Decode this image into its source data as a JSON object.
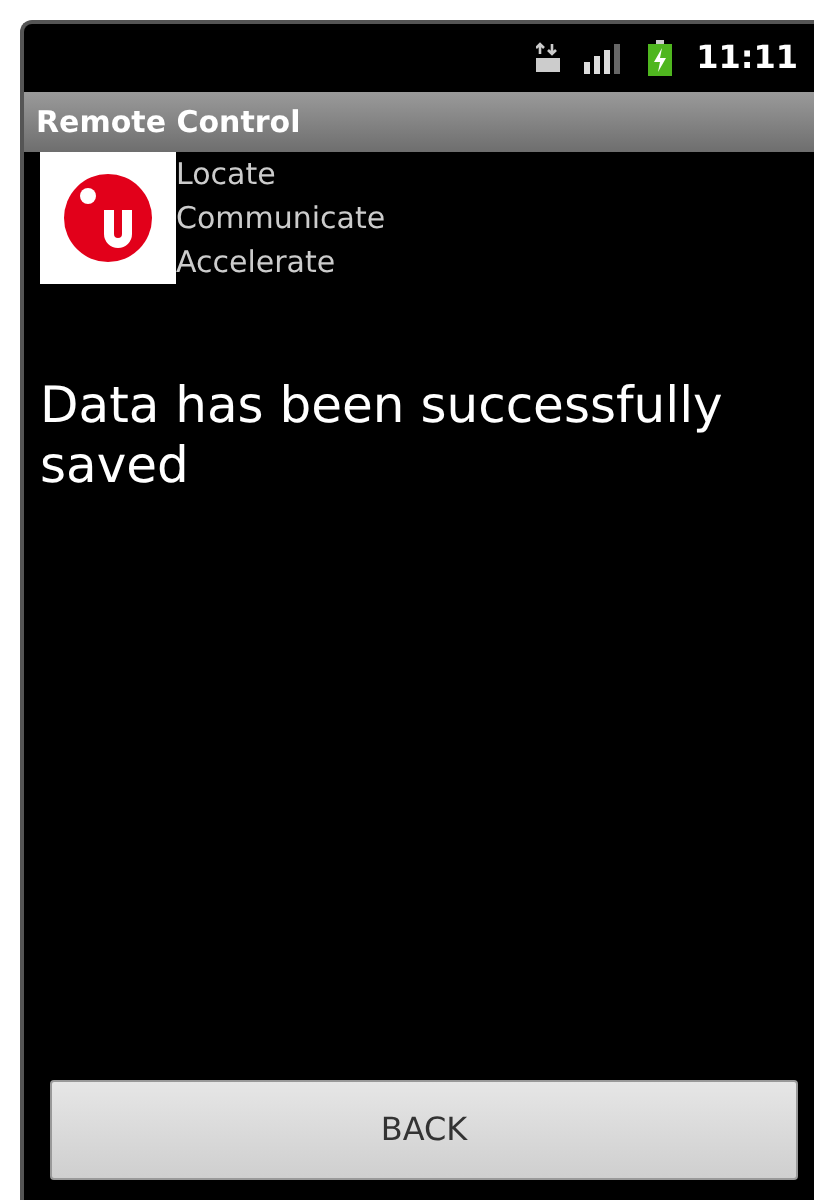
{
  "status_bar": {
    "time": "11:11"
  },
  "window": {
    "title": "Remote Control"
  },
  "brand": {
    "taglines": [
      "Locate",
      "Communicate",
      "Accelerate"
    ]
  },
  "message": "Data has been successfully saved",
  "buttons": [
    "BACK"
  ]
}
